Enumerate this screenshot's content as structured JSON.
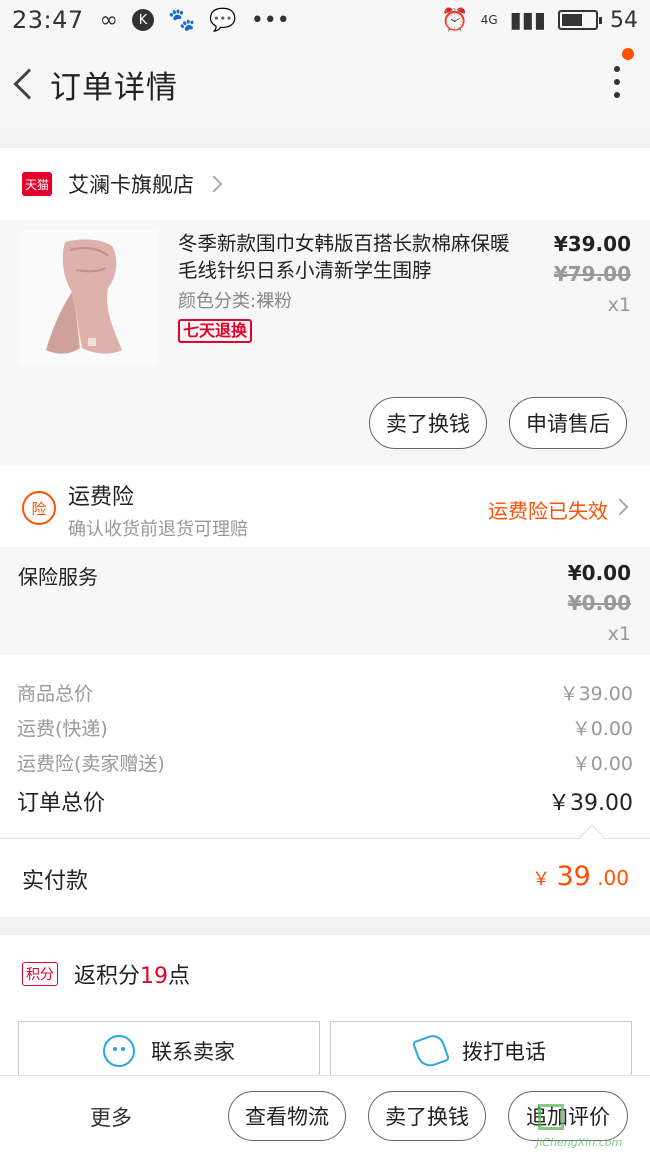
{
  "status_bar": {
    "time": "23:47",
    "battery": "54",
    "network": "4G"
  },
  "header": {
    "title": "订单详情"
  },
  "store": {
    "badge": "天猫",
    "name": "艾澜卡旗舰店"
  },
  "product": {
    "name": "冬季新款围巾女韩版百搭长款棉麻保暖毛线针织日系小清新学生围脖",
    "sku": "颜色分类:裸粉",
    "tag": "七天退换",
    "price": "¥39.00",
    "original_price": "¥79.00",
    "quantity": "x1",
    "actions": [
      "卖了换钱",
      "申请售后"
    ]
  },
  "freight_insurance": {
    "icon_text": "险",
    "title": "运费险",
    "subtitle": "确认收货前退货可理赔",
    "status": "运费险已失效"
  },
  "insurance_service": {
    "label": "保险服务",
    "price": "¥0.00",
    "original_price": "¥0.00",
    "quantity": "x1"
  },
  "totals": {
    "rows": [
      {
        "label": "商品总价",
        "value": "￥39.00"
      },
      {
        "label": "运费(快递)",
        "value": "￥0.00"
      },
      {
        "label": "运费险(卖家赠送)",
        "value": "￥0.00"
      }
    ],
    "order_total_label": "订单总价",
    "order_total": "￥39.00"
  },
  "payment": {
    "label": "实付款",
    "currency": "￥",
    "integer": "39",
    "decimal": ".00"
  },
  "points": {
    "tag": "积分",
    "prefix": "返积分",
    "value": "19",
    "suffix": "点"
  },
  "contact": {
    "seller": "联系卖家",
    "phone": "拨打电话"
  },
  "bottom_bar": {
    "more": "更多",
    "buttons": [
      "查看物流",
      "卖了换钱",
      "追加评价"
    ]
  },
  "watermark": {
    "site": "JiChengXin.com"
  },
  "colors": {
    "accent": "#ff5000",
    "tmall_red": "#e4002b",
    "icon_blue": "#2aa5e8"
  }
}
